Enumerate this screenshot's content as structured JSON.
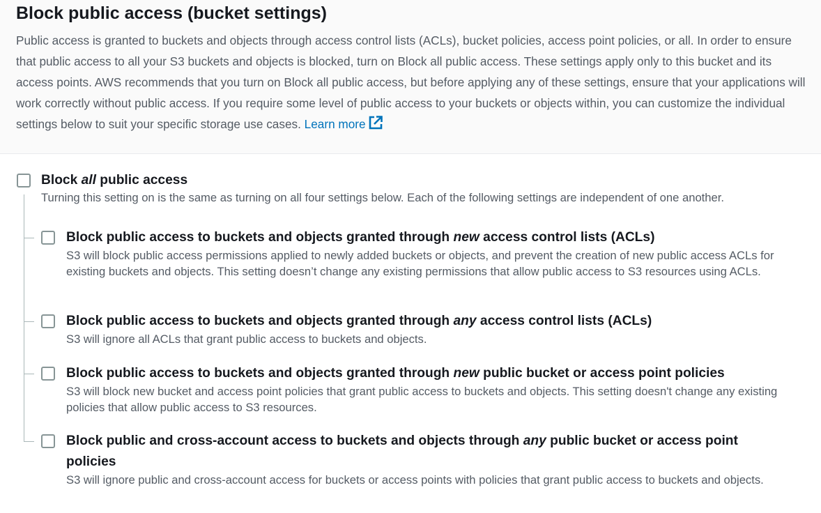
{
  "section": {
    "title": "Block public access (bucket settings)",
    "description": "Public access is granted to buckets and objects through access control lists (ACLs), bucket policies, access point policies, or all. In order to ensure that public access to all your S3 buckets and objects is blocked, turn on Block all public access. These settings apply only to this bucket and its access points. AWS recommends that you turn on Block all public access, but before applying any of these settings, ensure that your applications will work correctly without public access. If you require some level of public access to your buckets or objects within, you can customize the individual settings below to suit your specific storage use cases.",
    "learn_more": "Learn more",
    "link_icon": "external-link-icon"
  },
  "block_all": {
    "title_pre": "Block ",
    "title_em": "all",
    "title_post": " public access",
    "description": "Turning this setting on is the same as turning on all four settings below. Each of the following settings are independent of one another.",
    "checked": false
  },
  "options": [
    {
      "title_pre": "Block public access to buckets and objects granted through ",
      "title_em": "new",
      "title_post": " access control lists (ACLs)",
      "description": "S3 will block public access permissions applied to newly added buckets or objects, and prevent the creation of new public access ACLs for existing buckets and objects. This setting doesn’t change any existing permissions that allow public access to S3 resources using ACLs.",
      "checked": false
    },
    {
      "title_pre": "Block public access to buckets and objects granted through ",
      "title_em": "any",
      "title_post": " access control lists (ACLs)",
      "description": "S3 will ignore all ACLs that grant public access to buckets and objects.",
      "checked": false
    },
    {
      "title_pre": "Block public access to buckets and objects granted through ",
      "title_em": "new",
      "title_post": " public bucket or access point policies",
      "description": "S3 will block new bucket and access point policies that grant public access to buckets and objects. This setting doesn't change any existing policies that allow public access to S3 resources.",
      "checked": false
    },
    {
      "title_pre": "Block public and cross-account access to buckets and objects through ",
      "title_em": "any",
      "title_post": " public bucket or access point policies",
      "description": "S3 will ignore public and cross-account access for buckets or access points with policies that grant public access to buckets and objects.",
      "checked": false
    }
  ],
  "colors": {
    "link": "#0073bb",
    "text": "#16191f",
    "muted": "#545b64",
    "checkbox_border": "#879596",
    "panel_bg": "#fafafa"
  }
}
